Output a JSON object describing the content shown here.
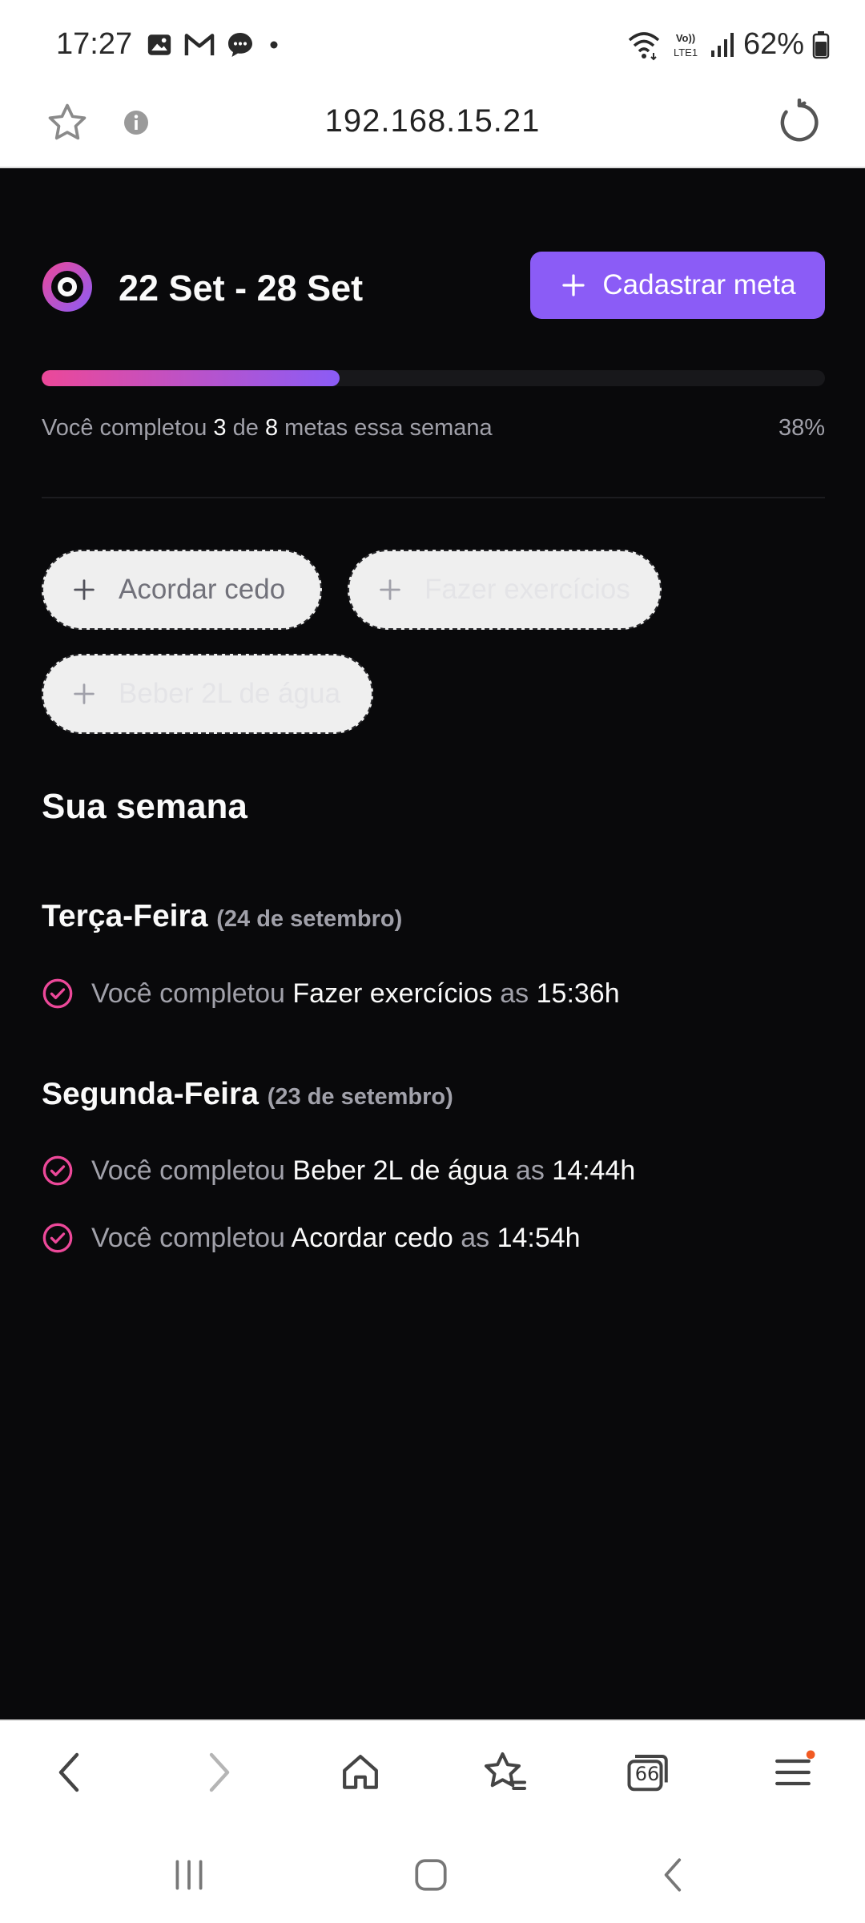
{
  "status_bar": {
    "time": "17:27",
    "battery": "62%",
    "network_label": "VoLTE1"
  },
  "browser": {
    "url": "192.168.15.21"
  },
  "app": {
    "week_range": "22 Set - 28 Set",
    "add_goal_label": "Cadastrar meta",
    "progress": {
      "prefix": "Você completou",
      "completed": "3",
      "middle": "de",
      "total": "8",
      "suffix": "metas essa semana",
      "percent_text": "38%",
      "fraction": 0.38
    },
    "pending_goals": [
      {
        "label": "Acordar cedo",
        "disabled": true
      },
      {
        "label": "Fazer exercícios",
        "disabled": false
      },
      {
        "label": "Beber 2L de água",
        "disabled": false
      }
    ],
    "section_title": "Sua semana",
    "days": [
      {
        "name": "Terça-Feira",
        "date": "(24 de setembro)",
        "entries": [
          {
            "prefix": "Você completou",
            "goal": "Fazer exercícios",
            "joiner": "as",
            "time": "15:36h"
          }
        ]
      },
      {
        "name": "Segunda-Feira",
        "date": "(23 de setembro)",
        "entries": [
          {
            "prefix": "Você completou",
            "goal": "Beber 2L de água",
            "joiner": "as",
            "time": "14:44h"
          },
          {
            "prefix": "Você completou",
            "goal": "Acordar cedo",
            "joiner": "as",
            "time": "14:54h"
          }
        ]
      }
    ]
  },
  "toolbar": {
    "tab_count": "66"
  },
  "colors": {
    "background": "#09090b",
    "accent": "#8b5cf6",
    "pink": "#ec4899",
    "muted_text": "#a1a1aa"
  }
}
